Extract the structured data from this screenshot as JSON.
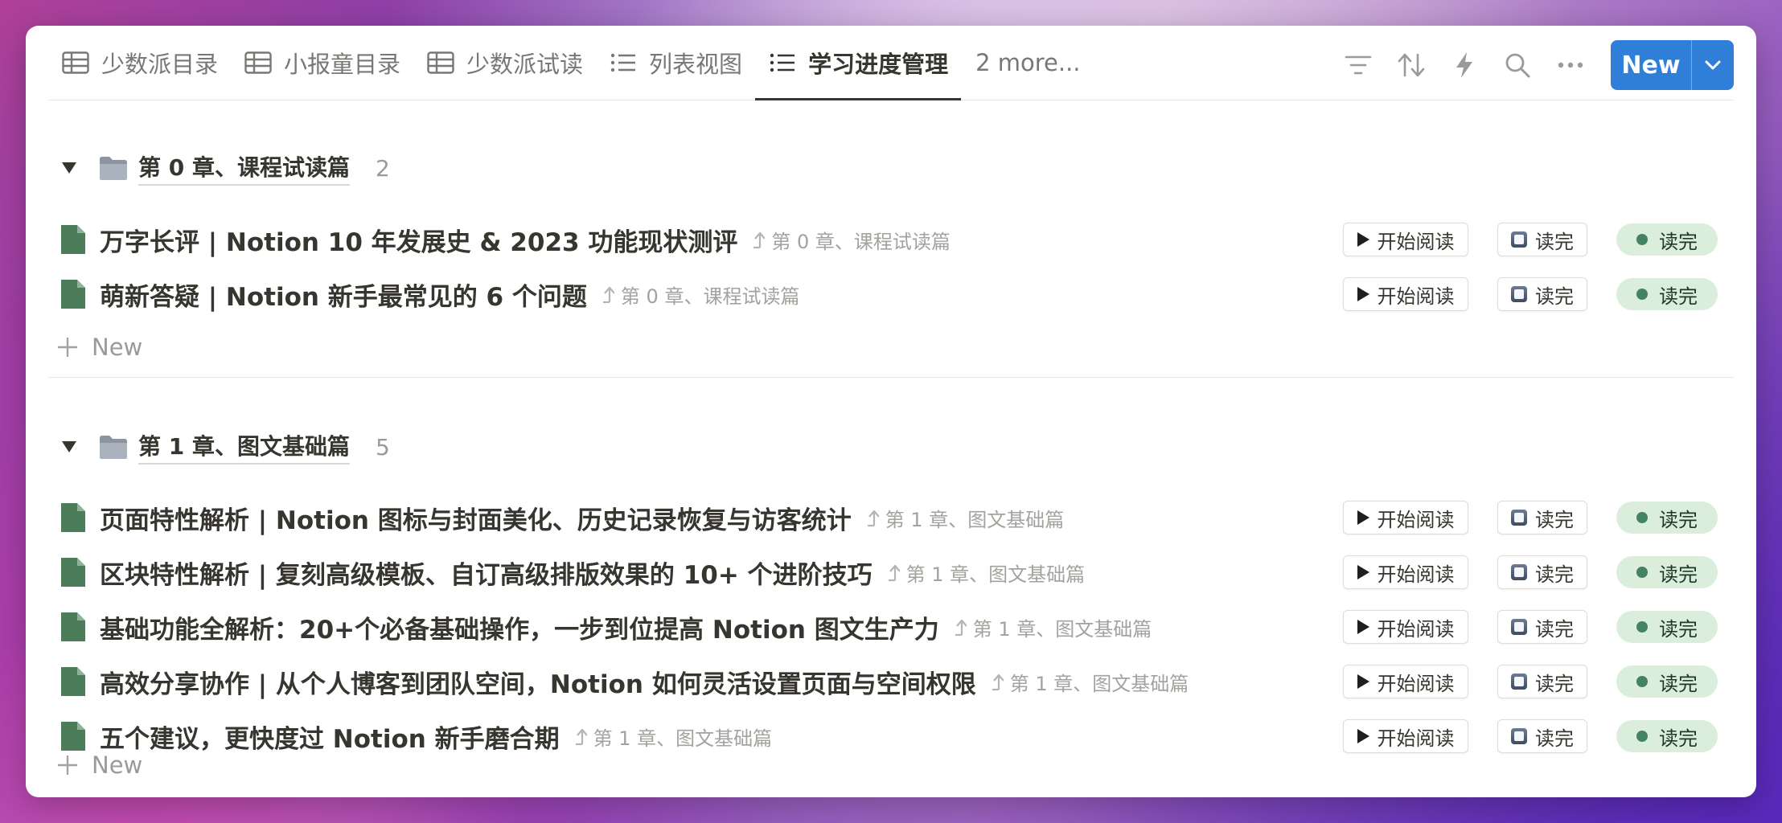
{
  "colors": {
    "accent": "#2f7fd8",
    "doc_icon": "#4d7c5b",
    "status_bg": "#dbeddb",
    "status_dot": "#448361"
  },
  "tabs": [
    {
      "label": "少数派目录",
      "icon": "table-icon"
    },
    {
      "label": "小报童目录",
      "icon": "table-icon"
    },
    {
      "label": "少数派试读",
      "icon": "table-icon"
    },
    {
      "label": "列表视图",
      "icon": "list-icon"
    },
    {
      "label": "学习进度管理",
      "icon": "list-icon",
      "active": true
    }
  ],
  "more_tabs_label": "2 more...",
  "toolbar": {
    "new_label": "New"
  },
  "groups": [
    {
      "title": "第 0 章、课程试读篇",
      "count": "2",
      "items": [
        {
          "title": "万字长评 | Notion 10 年发展史 & 2023 功能现状测评",
          "parent": "第 0 章、课程试读篇",
          "start_label": "开始阅读",
          "done_label": "读完",
          "status": "读完"
        },
        {
          "title": "萌新答疑 | Notion 新手最常见的 6 个问题",
          "parent": "第 0 章、课程试读篇",
          "start_label": "开始阅读",
          "done_label": "读完",
          "status": "读完"
        }
      ],
      "add_label": "New"
    },
    {
      "title": "第 1 章、图文基础篇",
      "count": "5",
      "items": [
        {
          "title": "页面特性解析 | Notion 图标与封面美化、历史记录恢复与访客统计",
          "parent": "第 1 章、图文基础篇",
          "start_label": "开始阅读",
          "done_label": "读完",
          "status": "读完"
        },
        {
          "title": "区块特性解析 | 复刻高级模板、自订高级排版效果的 10+ 个进阶技巧",
          "parent": "第 1 章、图文基础篇",
          "start_label": "开始阅读",
          "done_label": "读完",
          "status": "读完"
        },
        {
          "title": "基础功能全解析：20+个必备基础操作，一步到位提高 Notion 图文生产力",
          "parent": "第 1 章、图文基础篇",
          "start_label": "开始阅读",
          "done_label": "读完",
          "status": "读完"
        },
        {
          "title": "高效分享协作 | 从个人博客到团队空间，Notion 如何灵活设置页面与空间权限",
          "parent": "第 1 章、图文基础篇",
          "start_label": "开始阅读",
          "done_label": "读完",
          "status": "读完"
        },
        {
          "title": "五个建议，更快度过 Notion 新手磨合期",
          "parent": "第 1 章、图文基础篇",
          "start_label": "开始阅读",
          "done_label": "读完",
          "status": "读完"
        }
      ],
      "add_label": "New"
    }
  ]
}
